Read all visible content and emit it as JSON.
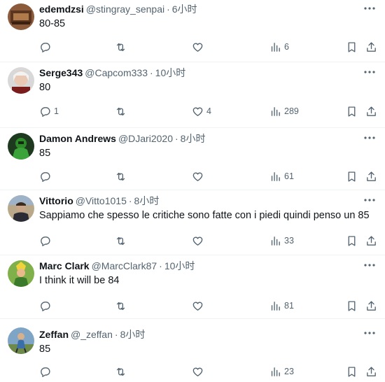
{
  "tweets": [
    {
      "name": "edemdzsi",
      "handle": "@stingray_senpai",
      "sep": "·",
      "time": "6小时",
      "text": "80-85",
      "reply_count": "",
      "retweet_count": "",
      "like_count": "",
      "view_count": "6"
    },
    {
      "name": "Serge343",
      "handle": "@Capcom333",
      "sep": "·",
      "time": "10小时",
      "text": "80",
      "reply_count": "1",
      "retweet_count": "",
      "like_count": "4",
      "view_count": "289"
    },
    {
      "name": "Damon Andrews",
      "handle": "@DJari2020",
      "sep": "·",
      "time": "8小时",
      "text": "85",
      "reply_count": "",
      "retweet_count": "",
      "like_count": "",
      "view_count": "61"
    },
    {
      "name": "Vittorio",
      "handle": "@Vitto1015",
      "sep": "·",
      "time": "8小时",
      "text": "Sappiamo che spesso le critiche sono fatte con i piedi quindi penso un 85",
      "reply_count": "",
      "retweet_count": "",
      "like_count": "",
      "view_count": "33"
    },
    {
      "name": "Marc Clark",
      "handle": "@MarcClark87",
      "sep": "·",
      "time": "10小时",
      "text": "I think it will be 84",
      "reply_count": "",
      "retweet_count": "",
      "like_count": "",
      "view_count": "81"
    },
    {
      "name": "Zeffan",
      "handle": "@_zeffan",
      "sep": "·",
      "time": "8小时",
      "text": "85",
      "reply_count": "",
      "retweet_count": "",
      "like_count": "",
      "view_count": "23"
    }
  ],
  "icons": {
    "more": "more-dots-icon",
    "reply": "reply-icon",
    "retweet": "retweet-icon",
    "like": "heart-icon",
    "views": "views-bar-chart-icon",
    "bookmark": "bookmark-icon",
    "share": "share-icon"
  },
  "colors": {
    "text": "#0f1419",
    "secondary": "#536471",
    "divider": "#eff3f4"
  }
}
